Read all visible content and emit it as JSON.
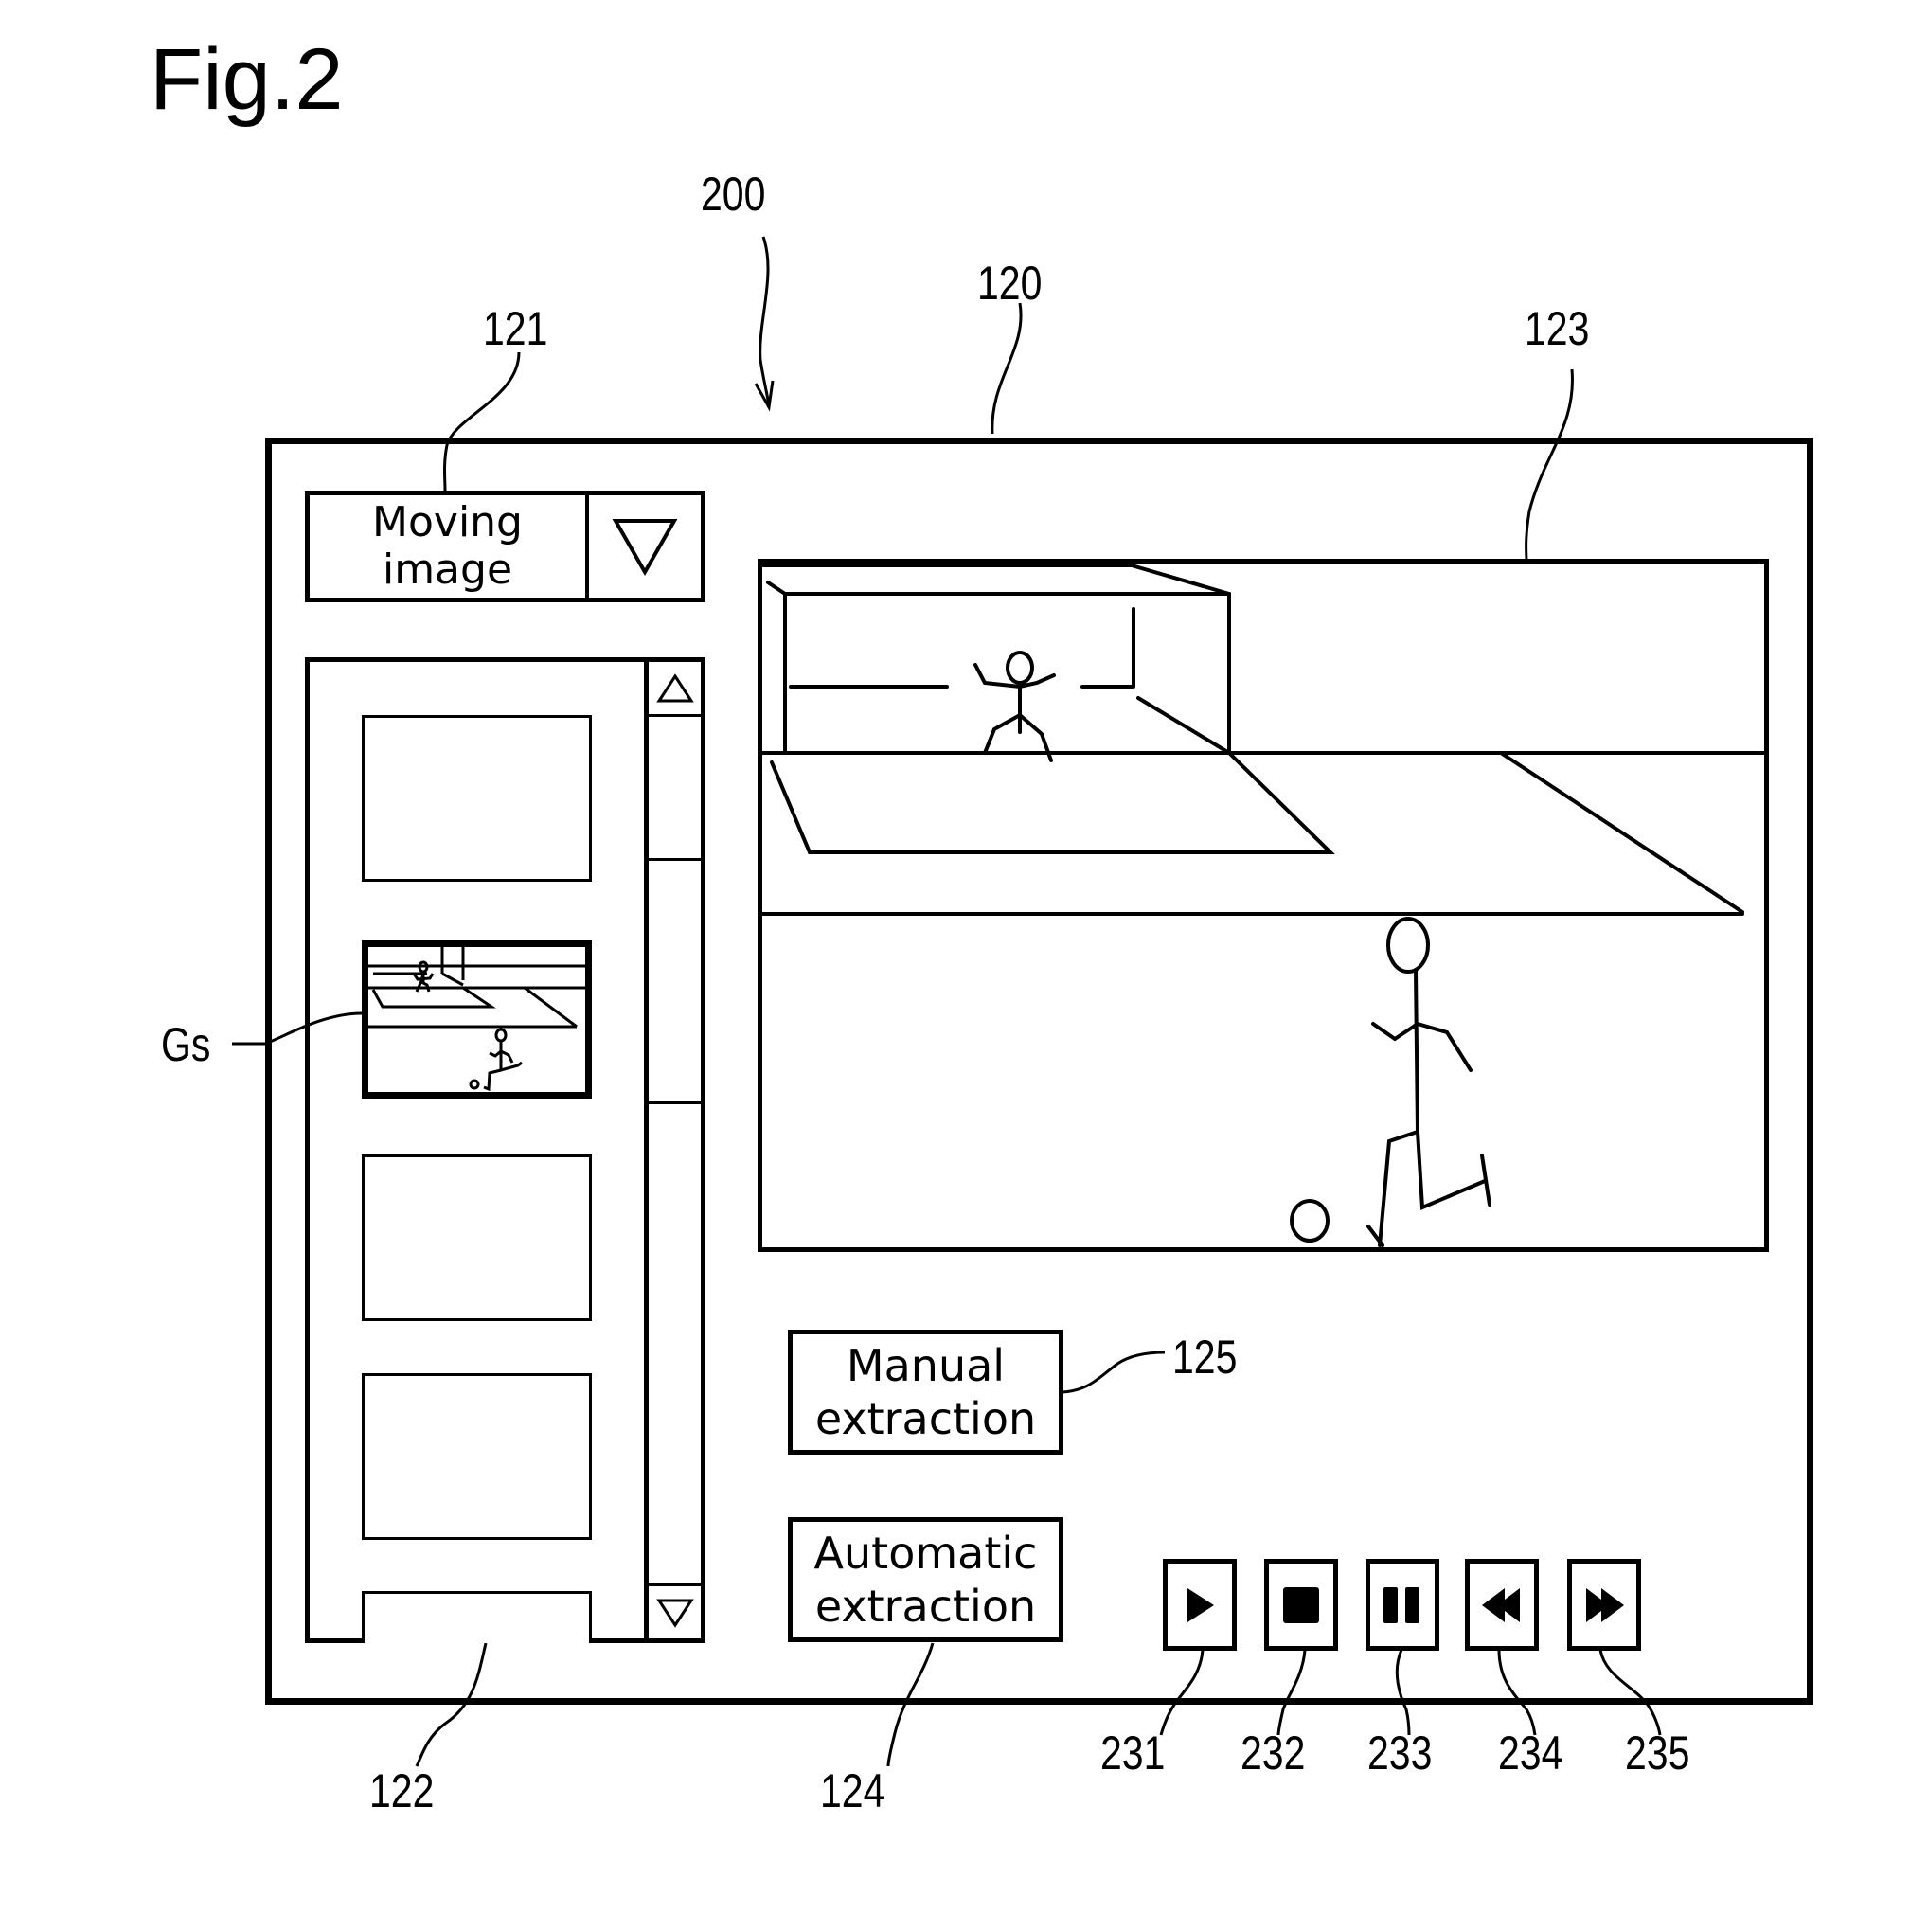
{
  "figure": {
    "title": "Fig.2"
  },
  "reference_labels": {
    "screen": "200",
    "window": "120",
    "source_selector": "121",
    "thumbnail_list": "122",
    "video_display": "123",
    "automatic_extraction": "124",
    "manual_extraction": "125",
    "selected_thumbnail": "Gs",
    "play": "231",
    "stop": "232",
    "pause": "233",
    "rewind": "234",
    "fast_forward": "235"
  },
  "source_selector": {
    "value_line1": "Moving",
    "value_line2": "image",
    "dropdown_icon": "triangle-down-outline"
  },
  "thumbnail_list": {
    "items": [
      {
        "content": "blank",
        "selected": false
      },
      {
        "content": "soccer-scene",
        "selected": true
      },
      {
        "content": "blank",
        "selected": false
      },
      {
        "content": "blank",
        "selected": false
      },
      {
        "content": "blank-partial",
        "selected": false
      }
    ],
    "scroll_up_icon": "triangle-up-outline",
    "scroll_down_icon": "triangle-down-outline"
  },
  "video_display": {
    "scene": "soccer goalkeeper and kicker"
  },
  "buttons": {
    "manual_line1": "Manual",
    "manual_line2": "extraction",
    "automatic_line1": "Automatic",
    "automatic_line2": "extraction"
  },
  "media_controls": [
    {
      "name": "play",
      "icon": "play-icon"
    },
    {
      "name": "stop",
      "icon": "stop-icon"
    },
    {
      "name": "pause",
      "icon": "pause-icon"
    },
    {
      "name": "rewind",
      "icon": "rewind-icon"
    },
    {
      "name": "fast-forward",
      "icon": "fast-forward-icon"
    }
  ]
}
